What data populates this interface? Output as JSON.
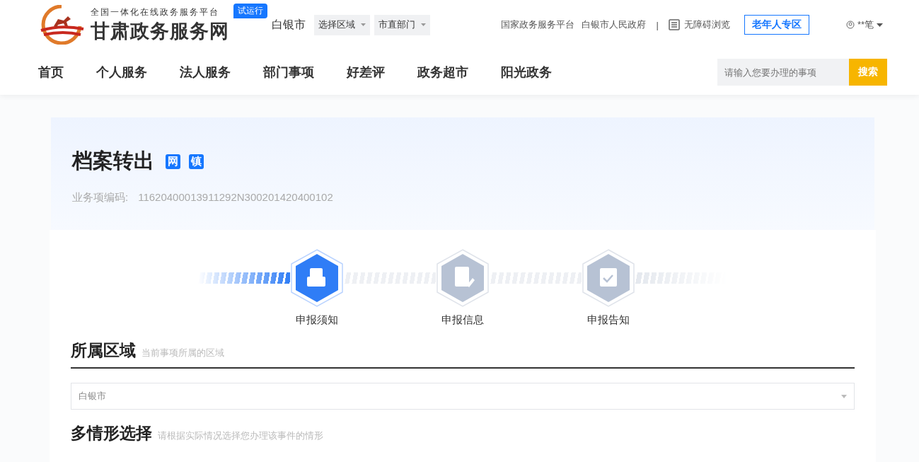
{
  "header": {
    "logo_subtitle": "全国一体化在线政务服务平台",
    "logo_title": "甘肃政务服务网",
    "trial_badge": "试运行",
    "city": "白银市",
    "region_select": "选择区域",
    "dept_select": "市直部门",
    "links": [
      "国家政务服务平台",
      "白银市人民政府"
    ],
    "separator": "|",
    "accessibility": "无障碍浏览",
    "elderly_button": "老年人专区",
    "user": "**笔"
  },
  "nav": {
    "items": [
      "首页",
      "个人服务",
      "法人服务",
      "部门事项",
      "好差评",
      "政务超市",
      "阳光政务"
    ],
    "search": {
      "placeholder": "请输入您要办理的事项",
      "button": "搜索"
    }
  },
  "item": {
    "title": "档案转出",
    "tags": [
      "网",
      "镇"
    ],
    "code_label": "业务项编码:",
    "code": "11620400013911292N300201420400102"
  },
  "steps": [
    {
      "label": "申报须知",
      "selected": true,
      "kind": "notice"
    },
    {
      "label": "申报信息",
      "selected": false,
      "kind": "form"
    },
    {
      "label": "申报告知",
      "selected": false,
      "kind": "clipboard"
    }
  ],
  "sections": [
    {
      "title": "所属区域",
      "hint": "当前事项所属的区域",
      "select_value": "白银市"
    },
    {
      "title": "多情形选择",
      "hint": "请根据实际情况选择您办理该事件的情形"
    }
  ]
}
